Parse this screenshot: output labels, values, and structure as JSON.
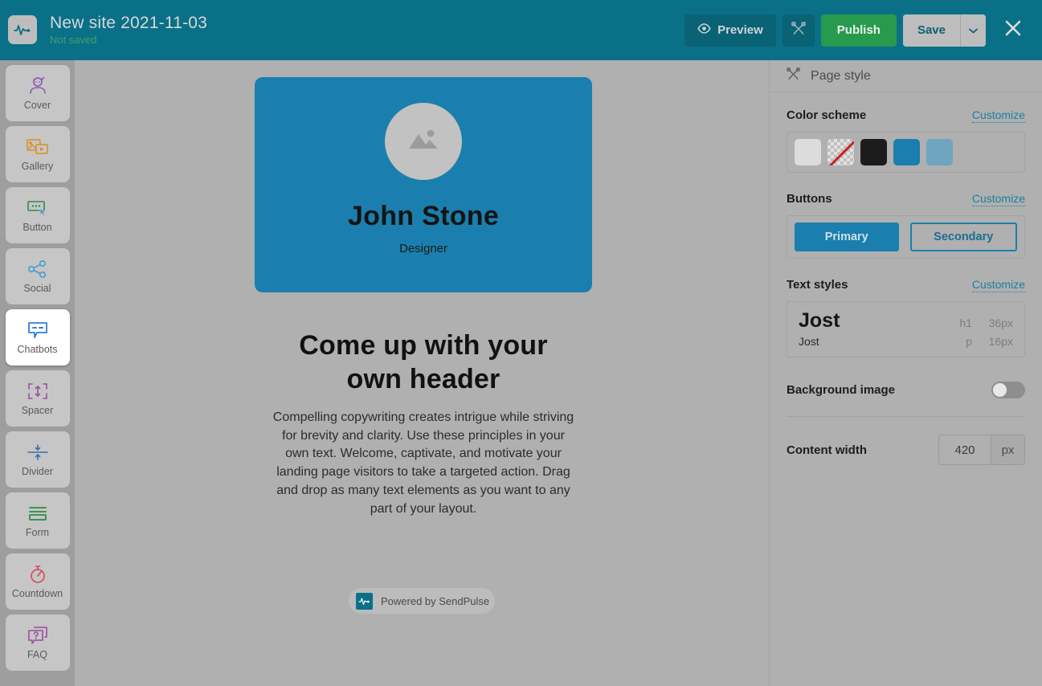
{
  "topbar": {
    "logo_icon": "pulse-wave-icon",
    "title": "New site 2021-11-03",
    "save_status": "Not saved",
    "preview_label": "Preview",
    "preview_icon": "eye-icon",
    "style_icon": "crossed-brushes-icon",
    "publish_label": "Publish",
    "save_label": "Save",
    "save_caret_icon": "chevron-down-icon",
    "close_icon": "close-icon",
    "bar_color": "#0a7087",
    "publish_color": "#289a4e"
  },
  "sidebar": {
    "items": [
      {
        "label": "Cover",
        "icon": "cover-person-icon",
        "color": "#8e5bb5",
        "active": false
      },
      {
        "label": "Gallery",
        "icon": "gallery-media-icon",
        "color": "#d98f23",
        "active": false
      },
      {
        "label": "Button",
        "icon": "button-cursor-icon",
        "color": "#2e8b46",
        "active": false
      },
      {
        "label": "Social",
        "icon": "share-nodes-icon",
        "color": "#3f9fd0",
        "active": false
      },
      {
        "label": "Chatbots",
        "icon": "chat-bubble-icon",
        "color": "#2b7fe0",
        "active": true
      },
      {
        "label": "Spacer",
        "icon": "spacer-arrows-icon",
        "color": "#9b4f9e",
        "active": false
      },
      {
        "label": "Divider",
        "icon": "divider-arrows-icon",
        "color": "#3a6fa8",
        "active": false
      },
      {
        "label": "Form",
        "icon": "form-lines-icon",
        "color": "#2e8b46",
        "active": false
      },
      {
        "label": "Countdown",
        "icon": "stopwatch-icon",
        "color": "#d6455f",
        "active": false
      },
      {
        "label": "FAQ",
        "icon": "faq-question-icon",
        "color": "#9b4f9e",
        "active": false
      }
    ]
  },
  "canvas": {
    "cover": {
      "background_color": "#1a7fae",
      "avatar_icon": "image-placeholder-icon",
      "name": "John Stone",
      "role": "Designer"
    },
    "headline": "Come up with your own header",
    "body": "Compelling copywriting creates intrigue while striving for brevity and clarity. Use these principles in your own text. Welcome, captivate, and motivate your landing page visitors to take a targeted action. Drag and drop as many text elements as you want to any part of your layout.",
    "powered_by": {
      "text": "Powered by SendPulse",
      "logo_icon": "pulse-wave-icon"
    }
  },
  "panel": {
    "header": {
      "icon": "crossed-brushes-icon",
      "title": "Page style"
    },
    "color_scheme": {
      "title": "Color scheme",
      "customize_label": "Customize",
      "swatches": [
        {
          "name": "light-gray",
          "color": "#dcdcdc",
          "transparent": false
        },
        {
          "name": "transparent",
          "color": "transparent",
          "transparent": true
        },
        {
          "name": "black",
          "color": "#1c1c1c",
          "transparent": false
        },
        {
          "name": "blue",
          "color": "#1a7fae",
          "transparent": false
        },
        {
          "name": "light-blue",
          "color": "#6fa5bf",
          "transparent": false
        }
      ]
    },
    "buttons": {
      "title": "Buttons",
      "customize_label": "Customize",
      "primary_label": "Primary",
      "secondary_label": "Secondary"
    },
    "text_styles": {
      "title": "Text styles",
      "customize_label": "Customize",
      "h1_sample": "Jost",
      "h1_tag": "h1",
      "h1_size": "36px",
      "p_sample": "Jost",
      "p_tag": "p",
      "p_size": "16px"
    },
    "background_image": {
      "label": "Background image",
      "enabled": false
    },
    "content_width": {
      "label": "Content width",
      "value": "420",
      "unit": "px"
    }
  }
}
